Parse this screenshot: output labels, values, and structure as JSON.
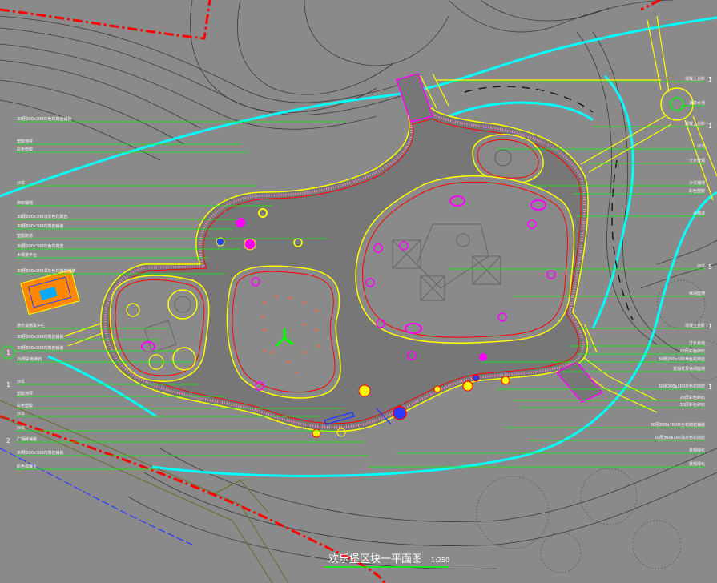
{
  "drawing": {
    "title": "欢乐堡区块一平面图",
    "scale": "1:250",
    "colors": {
      "background": "#8a8a8a",
      "callout_line": "#00ff00",
      "boundary_red": "#ff0000",
      "path_cyan": "#00ffff",
      "edge_yellow": "#ffff00",
      "edge_magenta": "#ff00ff",
      "contour": "#3a3a3a",
      "detail_blue": "#2a3cff"
    }
  },
  "left_labels": [
    "30厚300x300灰色花岗岩铺装",
    "塑胶地坪",
    "彩色塑胶",
    "沙坑",
    "卵石铺地",
    "30厚300x300浅灰色花岗岩",
    "30厚300x300花岗岩铺装",
    "塑胶跑道",
    "30厚200x300灰色花岗岩",
    "木栈道平台",
    "30厚300x300深灰色花岗岩铺装",
    "游乐设施及护栏",
    "30厚300x300花岗岩铺装",
    "30厚300x300花岗岩铺装",
    "20厚彩色卵石",
    "沙坑",
    "塑胶地坪",
    "彩色塑胶",
    "沙坑",
    "沙坑",
    "广场砖铺装",
    "30厚200x300花岗岩铺装",
    "彩色混凝土"
  ],
  "left_numbers": [
    "1",
    "1",
    "2"
  ],
  "right_labels": [
    "混凝土台阶",
    "涌泉水池",
    "混凝土台阶",
    "沙坑",
    "汀步景观",
    "沙坑铺地",
    "彩色塑胶",
    "木栈道",
    "沙坑",
    "休闲座椅",
    "混凝土台阶",
    "汀步景观",
    "20厚彩色卵石",
    "30厚200x300黄色花岗岩",
    "景观灯及休闲座椅",
    "30厚200x300灰色花岗岩",
    "20厚彩色卵石",
    "20厚彩色卵石",
    "30厚200x700灰色花岗岩铺装",
    "30厚300x300浅灰色花岗岩",
    "景观绿化",
    "景观绿化"
  ],
  "right_numbers": [
    "1",
    "1",
    "1",
    "5",
    "1"
  ]
}
